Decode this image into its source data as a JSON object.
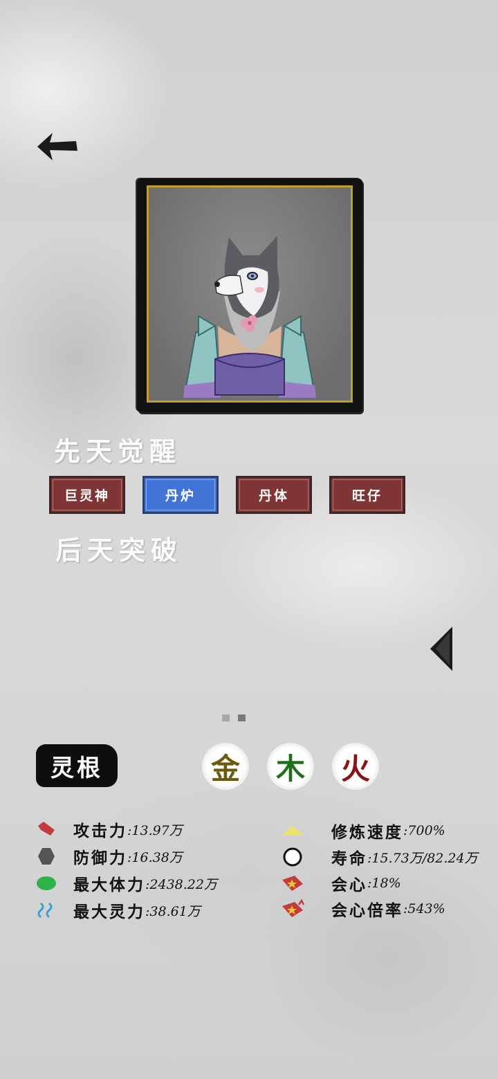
{
  "header": {
    "back_icon": "back-arrow-icon"
  },
  "sections": {
    "innate_title": "先天觉醒",
    "acquired_title": "后天突破"
  },
  "talents": [
    {
      "label": "巨灵神",
      "selected": false
    },
    {
      "label": "丹炉",
      "selected": true
    },
    {
      "label": "丹体",
      "selected": false
    },
    {
      "label": "旺仔",
      "selected": false
    }
  ],
  "pagination": {
    "pages": 2,
    "current": 2
  },
  "spirit_root": {
    "label": "灵根",
    "elements": [
      {
        "char": "金",
        "color": "#6b5a0e"
      },
      {
        "char": "木",
        "color": "#1f6e1a"
      },
      {
        "char": "火",
        "color": "#8a1414"
      }
    ]
  },
  "stats_left": [
    {
      "icon": "attack-icon",
      "label": "攻击力",
      "value": ":13.97万"
    },
    {
      "icon": "defense-icon",
      "label": "防御力",
      "value": ":16.38万"
    },
    {
      "icon": "health-icon",
      "label": "最大体力",
      "value": ":2438.22万"
    },
    {
      "icon": "spirit-icon",
      "label": "最大灵力",
      "value": ":38.61万"
    }
  ],
  "stats_right": [
    {
      "icon": "cultivation-speed-icon",
      "label": "修炼速度",
      "value": ":700%"
    },
    {
      "icon": "lifespan-icon",
      "label": "寿命",
      "value": ":15.73万/82.24万"
    },
    {
      "icon": "critical-icon",
      "label": "会心",
      "value": ":18%"
    },
    {
      "icon": "critical-multiplier-icon",
      "label": "会心倍率",
      "value": ":543%"
    }
  ]
}
